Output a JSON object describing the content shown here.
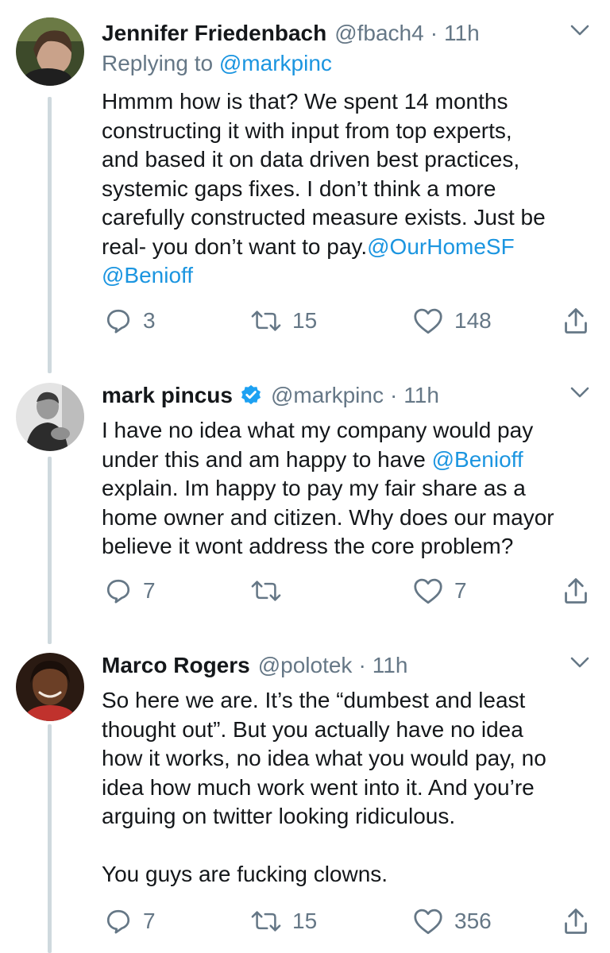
{
  "tweets": [
    {
      "name": "Jennifer Friedenbach",
      "handle": "@fbach4",
      "separator": "·",
      "time": "11h",
      "replying_prefix": "Replying to",
      "replying_to": "@markpinc",
      "body_lines": [
        "Hmmm how is that? We spent 14 months",
        "constructing it with input from top experts,",
        "and based it on data driven best practices,",
        "systemic gaps fixes. I don’t think a more",
        "carefully constructed measure exists. Just be"
      ],
      "body_line6_text": "real- you don’t want to pay.",
      "body_line6_mention": "@OurHomeSF",
      "body_line7_mention": "@Benioff",
      "replies": "3",
      "retweets": "15",
      "likes": "148"
    },
    {
      "name": "mark pincus",
      "verified": true,
      "handle": "@markpinc",
      "separator": "·",
      "time": "11h",
      "body_line1": "I have no idea what my company would pay",
      "body_line2_text": "under this and am happy to have ",
      "body_line2_mention": "@Benioff",
      "body_line3": "explain. Im happy to pay my fair share as a",
      "body_line4": "home owner and citizen. Why does our mayor",
      "body_line5": "believe it wont address the core problem?",
      "replies": "7",
      "retweets": "",
      "likes": "7"
    },
    {
      "name": "Marco Rogers",
      "handle": "@polotek",
      "separator": "·",
      "time": "11h",
      "body_lines": [
        "So here we are. It’s the “dumbest and least",
        "thought out”. But you actually have no idea",
        "how it works, no idea what you would pay, no",
        "idea how much work went into it. And you’re",
        "arguing on twitter looking ridiculous."
      ],
      "body_closing": "You guys are fucking clowns.",
      "replies": "7",
      "retweets": "15",
      "likes": "356"
    }
  ],
  "icons": {
    "reply": "reply-icon",
    "retweet": "retweet-icon",
    "like": "heart-icon",
    "share": "share-icon",
    "caret": "chevron-down-icon",
    "verified": "verified-badge-icon"
  },
  "colors": {
    "text": "#14171a",
    "secondary": "#657786",
    "link": "#1b95e0",
    "verified": "#1da1f2",
    "thread_line": "#cfd9de"
  }
}
